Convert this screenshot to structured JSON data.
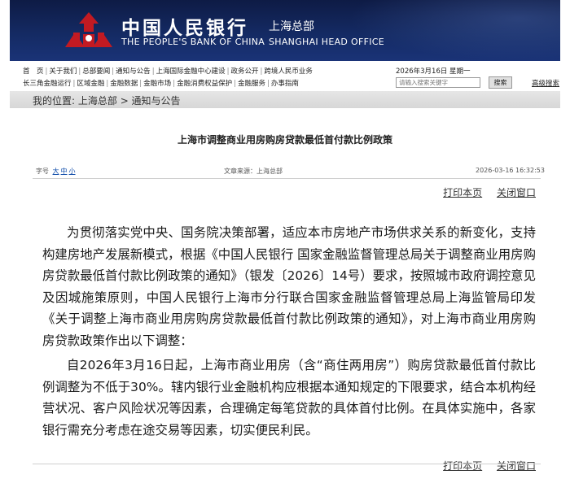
{
  "header": {
    "cn_name": "中国人民银行",
    "cn_office": "上海总部",
    "en_name": "THE PEOPLE'S BANK OF CHINA",
    "en_office": "SHANGHAI HEAD OFFICE",
    "logo_icon": "pboc-emblem-icon",
    "brand_color": "#b3191f",
    "bar_color": "#142a63"
  },
  "nav": {
    "row1": [
      "首　页",
      "关于我们",
      "总部要闻",
      "通知与公告",
      "上海国际金融中心建设",
      "政务公开",
      "跨境人民币业务"
    ],
    "row2": [
      "长三角金融运行",
      "区域金融",
      "金融数据",
      "金融市场",
      "金融消费权益保护",
      "金融服务",
      "办事指南"
    ],
    "date": "2026年3月16日 星期一",
    "search_placeholder": "请输入搜索关键字",
    "search_button": "搜索",
    "advanced_search": "高级搜索"
  },
  "breadcrumb": {
    "label": "我的位置:",
    "path": "上海总部 > 通知与公告"
  },
  "article": {
    "title": "上海市调整商业用房购房贷款最低首付款比例政策",
    "font_size_label": "字号",
    "font_sizes": [
      "大",
      "中",
      "小"
    ],
    "source": "文章来源：上海总部",
    "timestamp": "2026-03-16 16:32:53",
    "print_label": "打印本页",
    "close_label": "关闭窗口",
    "paragraphs": [
      "为贯彻落实党中央、国务院决策部署，适应本市房地产市场供求关系的新变化，支持构建房地产发展新模式，根据《中国人民银行 国家金融监督管理总局关于调整商业用房购房贷款最低首付款比例政策的通知》（银发〔2026〕14号）要求，按照城市政府调控意见及因城施策原则，中国人民银行上海市分行联合国家金融监督管理总局上海监管局印发《关于调整上海市商业用房购房贷款最低首付款比例政策的通知》，对上海市商业用房购房贷款政策作出以下调整：",
      "自2026年3月16日起，上海市商业用房（含“商住两用房”）购房贷款最低首付款比例调整为不低于30%。辖内银行业金融机构应根据本通知规定的下限要求，结合本机构经营状况、客户风险状况等因素，合理确定每笔贷款的具体首付比例。在具体实施中，各家银行需充分考虑在途交易等因素，切实便民利民。"
    ]
  }
}
